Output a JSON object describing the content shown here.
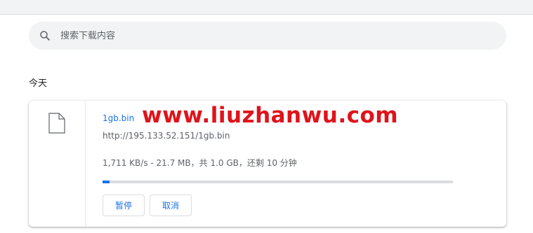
{
  "search": {
    "placeholder": "搜索下载内容",
    "icon": "search-icon"
  },
  "section": {
    "date_heading": "今天"
  },
  "download": {
    "file_name": "1gb.bin",
    "url": "http://195.133.52.151/1gb.bin",
    "status": "1,711 KB/s - 21.7 MB，共 1.0 GB，还剩 10 分钟",
    "progress_fraction": 0.02,
    "pause_label": "暂停",
    "cancel_label": "取消",
    "file_icon": "file-icon"
  },
  "watermark": "www.liuzhanwu.com",
  "colors": {
    "accent": "#1a73e8",
    "watermark": "#e0131a",
    "search_bg": "#f1f3f4",
    "progress_track": "#dadce0"
  }
}
